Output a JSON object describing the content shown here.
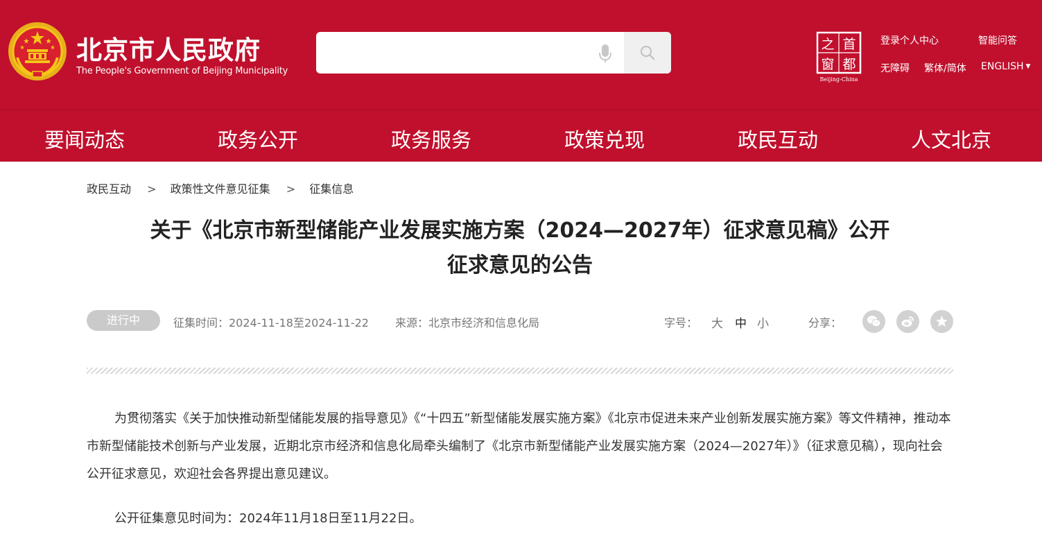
{
  "header": {
    "site_title": "北京市人民政府",
    "site_subtitle": "The People's Government of Beijing Municipality",
    "search": {
      "placeholder": ""
    },
    "capital_logo": {
      "chars": [
        "首",
        "都",
        "之",
        "窗"
      ],
      "caption": "Beijing-China"
    },
    "links": {
      "login": "登录个人中心",
      "qa": "智能问答",
      "accessibility": "无障碍",
      "traditional": "繁体/简体",
      "english": "ENGLISH"
    },
    "colors": {
      "brand_red": "#c0102d",
      "gold": "#f5c518"
    }
  },
  "nav": {
    "items": [
      "要闻动态",
      "政务公开",
      "政务服务",
      "政策兑现",
      "政民互动",
      "人文北京"
    ]
  },
  "breadcrumb": {
    "items": [
      "政民互动",
      "政策性文件意见征集",
      "征集信息"
    ],
    "separator": ">"
  },
  "article": {
    "title_line1": "关于《北京市新型储能产业发展实施方案（2024—2027年）征求意见稿》公开",
    "title_line2": "征求意见的公告",
    "status": "进行中",
    "collection_time": "征集时间：2024-11-18至2024-11-22",
    "source": "来源：北京市经济和信息化局",
    "font_size_label": "字号：",
    "font_sizes": {
      "large": "大",
      "medium": "中",
      "small": "小"
    },
    "share_label": "分享：",
    "share_icons": [
      "wechat-icon",
      "weibo-icon",
      "favorite-star-icon"
    ],
    "paragraphs": [
      "为贯彻落实《关于加快推动新型储能发展的指导意见》《“十四五”新型储能发展实施方案》《北京市促进未来产业创新发展实施方案》等文件精神，推动本市新型储能技术创新与产业发展，近期北京市经济和信息化局牵头编制了《北京市新型储能产业发展实施方案（2024—2027年）》（征求意见稿），现向社会公开征求意见，欢迎社会各界提出意见建议。",
      "公开征集意见时间为：2024年11月18日至11月22日。"
    ]
  }
}
